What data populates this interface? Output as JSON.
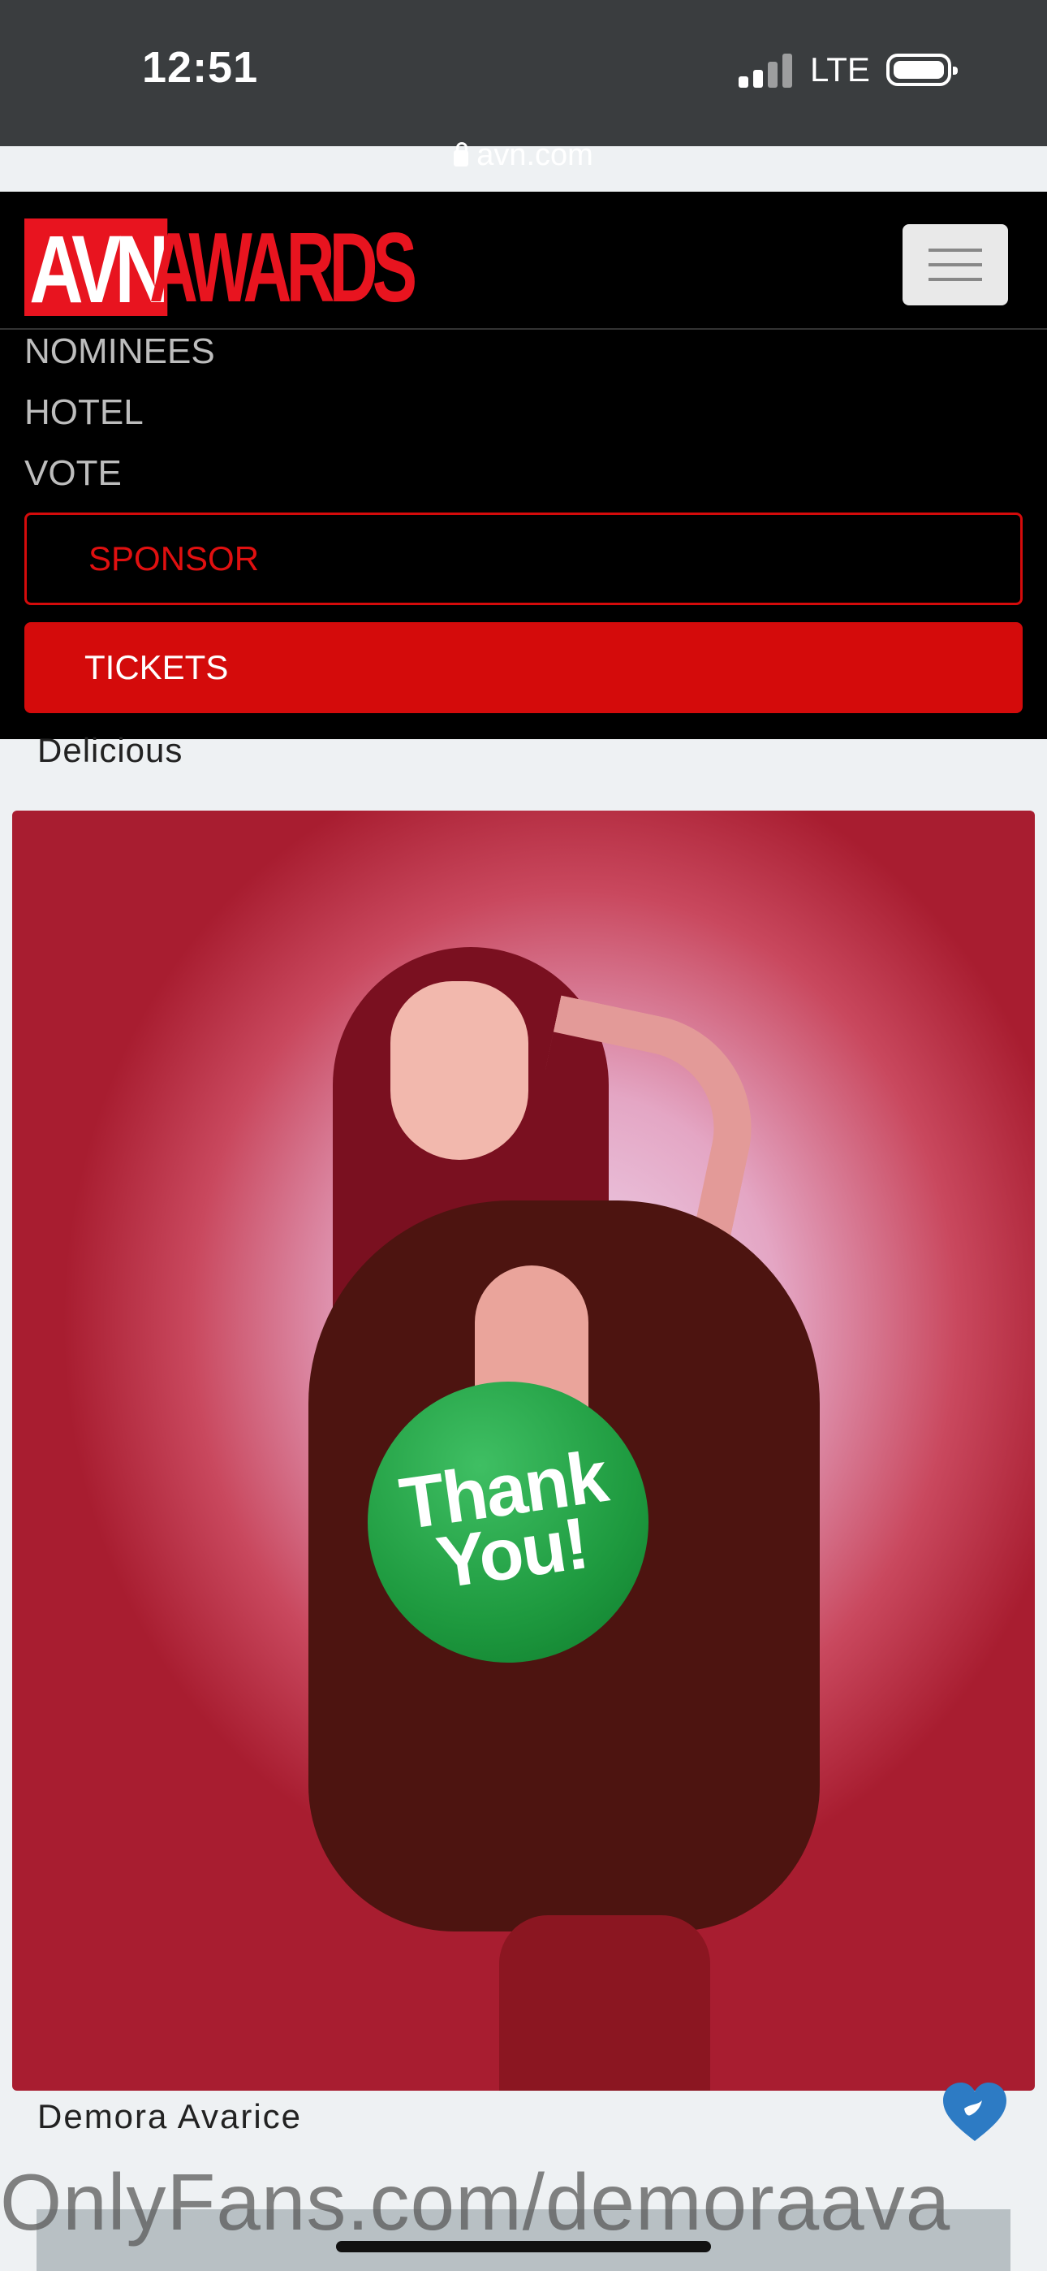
{
  "status_bar": {
    "time": "12:51",
    "network": "LTE"
  },
  "browser": {
    "url": "avn.com"
  },
  "nav": {
    "logo_prefix": "AVN",
    "logo_suffix": "AWARDS",
    "links": [
      "NOMINEES",
      "HOTEL",
      "VOTE"
    ],
    "sponsor_label": "SPONSOR",
    "tickets_label": "TICKETS"
  },
  "content": {
    "previous_caption": "Delicious",
    "photo_badge_line1": "Thank",
    "photo_badge_line2": "You!",
    "name_caption": "Demora Avarice",
    "watermark": "OnlyFans.com/demoraava"
  },
  "colors": {
    "brand_red": "#d40b0b",
    "badge_green": "#1e9a3f",
    "heart_blue": "#2d7bc4"
  }
}
